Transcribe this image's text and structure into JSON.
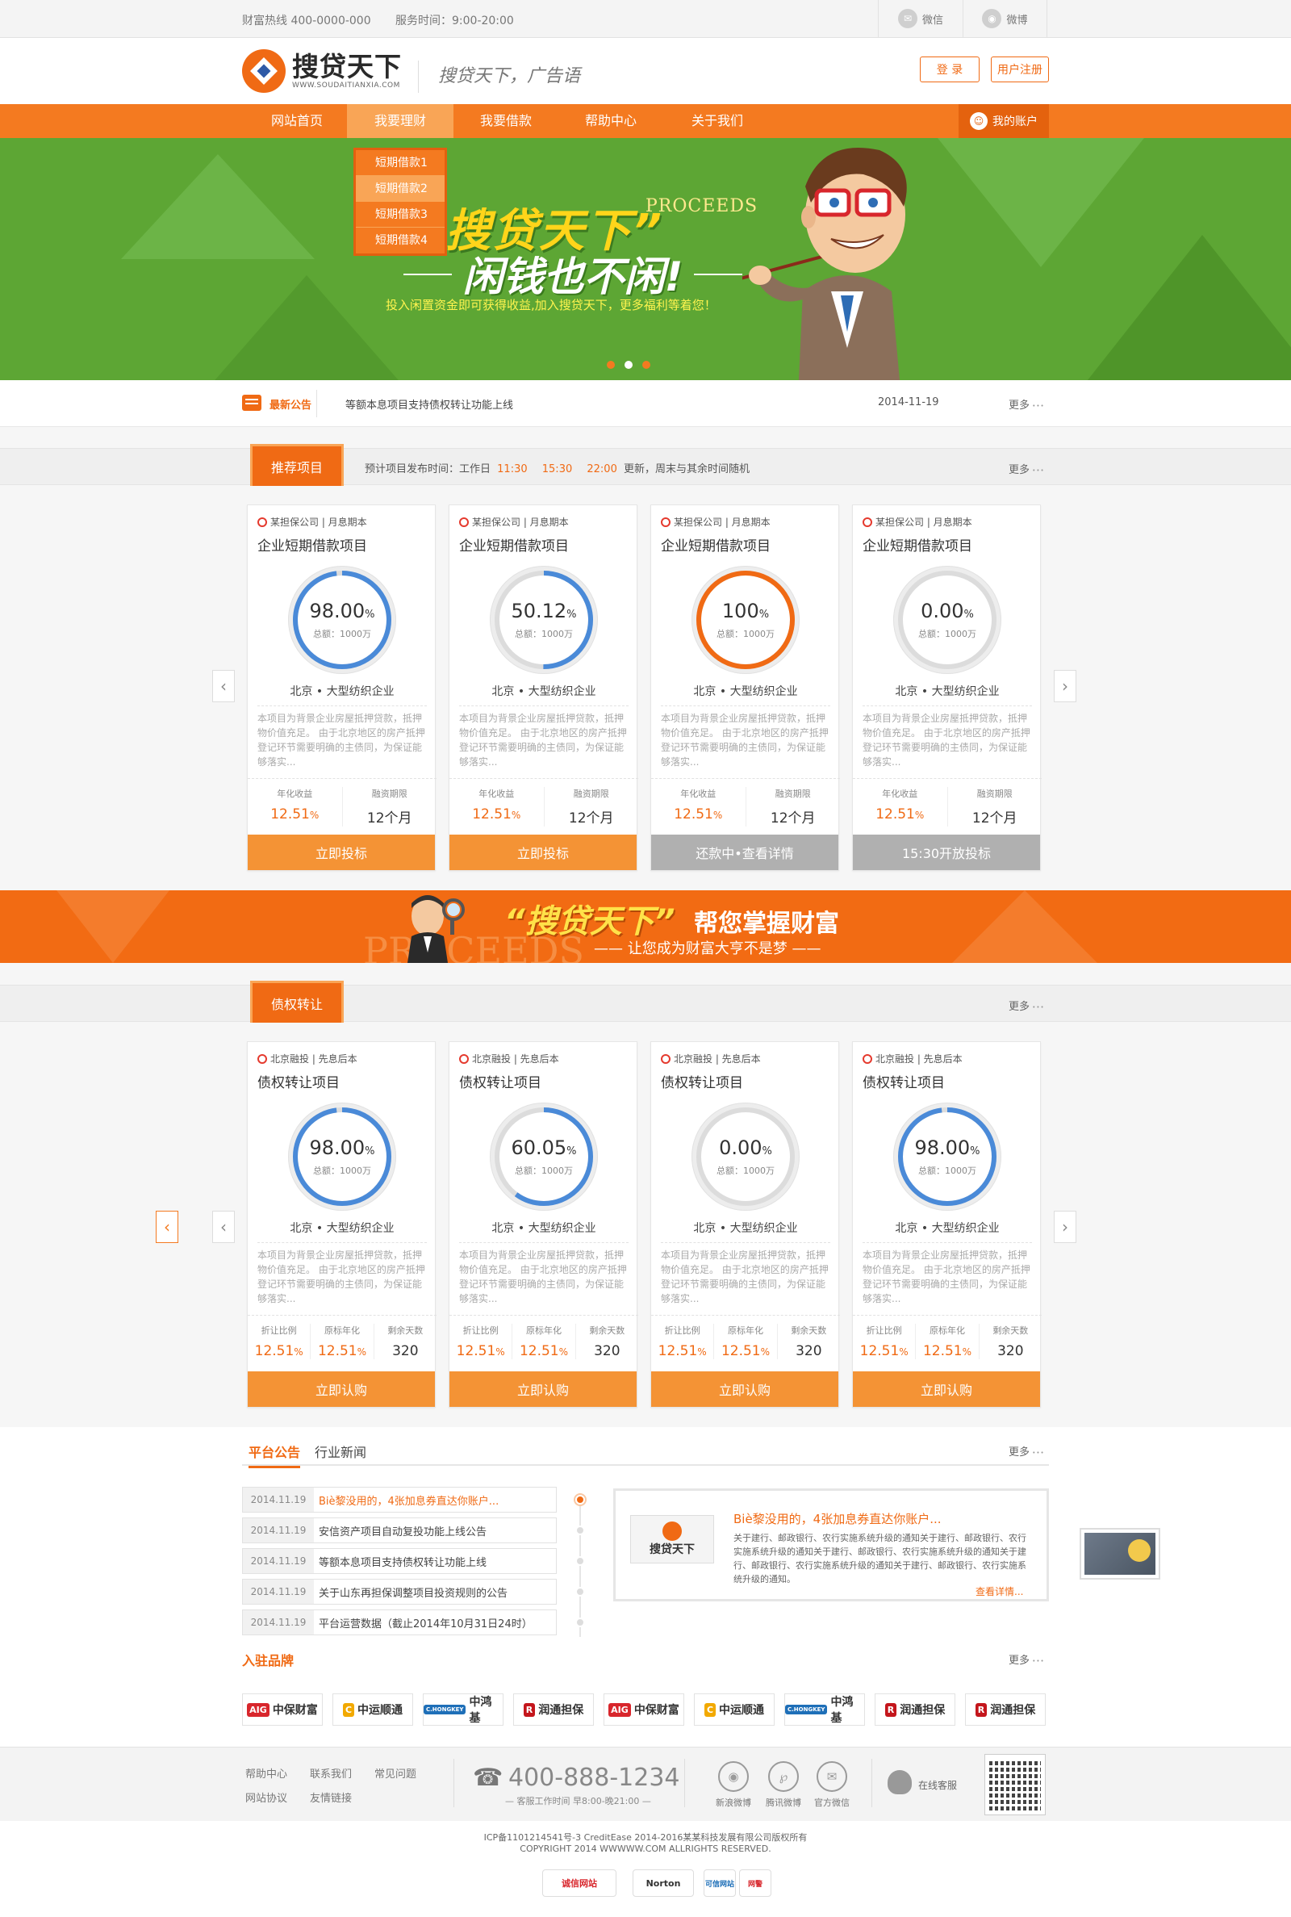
{
  "topbar": {
    "hotline": "财富热线  400-0000-000",
    "hours": "服务时间：9:00-20:00",
    "wechat": "微信",
    "weibo": "微博",
    "wechat_icon": "wechat-icon",
    "weibo_icon": "weibo-icon"
  },
  "header": {
    "logo_cn": "搜贷天下",
    "logo_en": "WWW.SOUDAITIANXIA.COM",
    "slogan": "搜贷天下，广告语",
    "login": "登 录",
    "register": "用户注册"
  },
  "nav": {
    "items": [
      "网站首页",
      "我要理财",
      "我要借款",
      "帮助中心",
      "关于我们"
    ],
    "active": "我要理财",
    "account": "我的账户"
  },
  "dropdown": {
    "items": [
      "短期借款1",
      "短期借款2",
      "短期借款3",
      "短期借款4"
    ],
    "highlighted": "短期借款2"
  },
  "banner": {
    "title": "搜贷天下”",
    "proceeds": "PROCEEDS",
    "subtitle": "闲钱也不闲!",
    "desc": "投入闲置资金即可获得收益,加入搜贷天下，更多福利等着您！",
    "slides": 3,
    "active_slide": 2
  },
  "notice": {
    "label": "最新公告",
    "text": "等额本息项目支持债权转让功能上线",
    "date": "2014-11-19",
    "more": "更多"
  },
  "recommend": {
    "tab": "推荐项目",
    "schedule_prefix": "预计项目发布时间：工作日",
    "times": [
      "11:30",
      "15:30",
      "22:00"
    ],
    "schedule_suffix": "更新，周末与其余时间随机",
    "more": "更多",
    "cards": [
      {
        "source": "某担保公司 | 月息期本",
        "title": "企业短期借款项目",
        "percent": "98.00",
        "pct_value": 98,
        "ring_color": "#4a8ad8",
        "total": "总额：1000万",
        "location": "北京 • 大型纺织企业",
        "desc": "本项目为背景企业房屋抵押贷款，抵押物价值充足。 由于北京地区的房产抵押登记环节需要明确的主债同，为保证能够落实...",
        "s1_label": "年化收益",
        "s1_value": "12.51",
        "s1_unit": "%",
        "s2_label": "融资期限",
        "s2_value": "12个月",
        "button": "立即投标",
        "button_gray": false
      },
      {
        "source": "某担保公司 | 月息期本",
        "title": "企业短期借款项目",
        "percent": "50.12",
        "pct_value": 50.12,
        "ring_color": "#4a8ad8",
        "total": "总额：1000万",
        "location": "北京 • 大型纺织企业",
        "desc": "本项目为背景企业房屋抵押贷款，抵押物价值充足。 由于北京地区的房产抵押登记环节需要明确的主债同，为保证能够落实...",
        "s1_label": "年化收益",
        "s1_value": "12.51",
        "s1_unit": "%",
        "s2_label": "融资期限",
        "s2_value": "12个月",
        "button": "立即投标",
        "button_gray": false
      },
      {
        "source": "某担保公司 | 月息期本",
        "title": "企业短期借款项目",
        "percent": "100",
        "pct_value": 100,
        "ring_color": "#f06a14",
        "total": "总额：1000万",
        "location": "北京 • 大型纺织企业",
        "desc": "本项目为背景企业房屋抵押贷款，抵押物价值充足。 由于北京地区的房产抵押登记环节需要明确的主债同，为保证能够落实...",
        "s1_label": "年化收益",
        "s1_value": "12.51",
        "s1_unit": "%",
        "s2_label": "融资期限",
        "s2_value": "12个月",
        "button": "还款中•查看详情",
        "button_gray": true
      },
      {
        "source": "某担保公司 | 月息期本",
        "title": "企业短期借款项目",
        "percent": "0.00",
        "pct_value": 0,
        "ring_color": "#aaaaaa",
        "total": "总额：1000万",
        "location": "北京 • 大型纺织企业",
        "desc": "本项目为背景企业房屋抵押贷款，抵押物价值充足。 由于北京地区的房产抵押登记环节需要明确的主债同，为保证能够落实...",
        "s1_label": "年化收益",
        "s1_value": "12.51",
        "s1_unit": "%",
        "s2_label": "融资期限",
        "s2_value": "12个月",
        "button": "15:30开放投标",
        "button_gray": true
      }
    ]
  },
  "promo": {
    "title": "“搜贷天下”",
    "title2": "帮您掌握财富",
    "sub": "—— 让您成为财富大亨不是梦 ——",
    "proceeds": "PROCEEDS"
  },
  "transfer": {
    "tab": "债权转让",
    "more": "更多",
    "cards": [
      {
        "source": "北京融投 | 先息后本",
        "title": "债权转让项目",
        "percent": "98.00",
        "pct_value": 98,
        "ring_color": "#4a8ad8",
        "total": "总额：1000万",
        "location": "北京 • 大型纺织企业",
        "desc": "本项目为背景企业房屋抵押贷款，抵押物价值充足。 由于北京地区的房产抵押登记环节需要明确的主债同，为保证能够落实...",
        "l1": "折让比例",
        "v1": "12.51",
        "l2": "原标年化",
        "v2": "12.51",
        "l3": "剩余天数",
        "v3": "320",
        "button": "立即认购"
      },
      {
        "source": "北京融投 | 先息后本",
        "title": "债权转让项目",
        "percent": "60.05",
        "pct_value": 60.05,
        "ring_color": "#4a8ad8",
        "total": "总额：1000万",
        "location": "北京 • 大型纺织企业",
        "desc": "本项目为背景企业房屋抵押贷款，抵押物价值充足。 由于北京地区的房产抵押登记环节需要明确的主债同，为保证能够落实...",
        "l1": "折让比例",
        "v1": "12.51",
        "l2": "原标年化",
        "v2": "12.51",
        "l3": "剩余天数",
        "v3": "320",
        "button": "立即认购"
      },
      {
        "source": "北京融投 | 先息后本",
        "title": "债权转让项目",
        "percent": "0.00",
        "pct_value": 0,
        "ring_color": "#aaaaaa",
        "total": "总额：1000万",
        "location": "北京 • 大型纺织企业",
        "desc": "本项目为背景企业房屋抵押贷款，抵押物价值充足。 由于北京地区的房产抵押登记环节需要明确的主债同，为保证能够落实...",
        "l1": "折让比例",
        "v1": "12.51",
        "l2": "原标年化",
        "v2": "12.51",
        "l3": "剩余天数",
        "v3": "320",
        "button": "立即认购"
      },
      {
        "source": "北京融投 | 先息后本",
        "title": "债权转让项目",
        "percent": "98.00",
        "pct_value": 98,
        "ring_color": "#4a8ad8",
        "total": "总额：1000万",
        "location": "北京 • 大型纺织企业",
        "desc": "本项目为背景企业房屋抵押贷款，抵押物价值充足。 由于北京地区的房产抵押登记环节需要明确的主债同，为保证能够落实...",
        "l1": "折让比例",
        "v1": "12.51",
        "l2": "原标年化",
        "v2": "12.51",
        "l3": "剩余天数",
        "v3": "320",
        "button": "立即认购"
      }
    ]
  },
  "news": {
    "tabs": [
      "平台公告",
      "行业新闻"
    ],
    "active_tab": "平台公告",
    "more": "更多",
    "rows": [
      {
        "date": "2014.11.19",
        "text": "Biè黎没用的，4张加息券直达你账户..."
      },
      {
        "date": "2014.11.19",
        "text": "安信资产项目自动复投功能上线公告"
      },
      {
        "date": "2014.11.19",
        "text": "等额本息项目支持债权转让功能上线"
      },
      {
        "date": "2014.11.19",
        "text": "关于山东再担保调整项目投资规则的公告"
      },
      {
        "date": "2014.11.19",
        "text": "平台运营数据（截止2014年10月31日24时）"
      }
    ],
    "detail_title": "Biè黎没用的，4张加息券直达你账户...",
    "detail_text": "关于建行、邮政银行、农行实施系统升级的通知关于建行、邮政银行、农行实施系统升级的通知关于建行、邮政银行、农行实施系统升级的通知关于建行、邮政银行、农行实施系统升级的通知关于建行、邮政银行、农行实施系统升级的通知。",
    "detail_more": "查看详情...",
    "detail_logo": "搜贷天下"
  },
  "brands": {
    "title": "入驻品牌",
    "more": "更多",
    "items": [
      {
        "mark": "AIG",
        "name": "中保财富",
        "color": "#d8262c"
      },
      {
        "mark": "C",
        "name": "中运顺通",
        "color": "#f2a900"
      },
      {
        "mark": "C.HONGKEY",
        "name": "中鸿基",
        "color": "#1e6fb8"
      },
      {
        "mark": "R",
        "name": "润通担保",
        "color": "#c4161c"
      },
      {
        "mark": "AIG",
        "name": "中保财富",
        "color": "#d8262c"
      },
      {
        "mark": "C",
        "name": "中运顺通",
        "color": "#f2a900"
      },
      {
        "mark": "C.HONGKEY",
        "name": "中鸿基",
        "color": "#1e6fb8"
      },
      {
        "mark": "R",
        "name": "润通担保",
        "color": "#c4161c"
      },
      {
        "mark": "R",
        "name": "润通担保",
        "color": "#c4161c"
      }
    ]
  },
  "footer": {
    "links": [
      "帮助中心",
      "联系我们",
      "常见问题",
      "网站协议",
      "友情链接"
    ],
    "phone": "400-888-1234",
    "hours": "— 客服工作时间 早8:00-晚21:00 —",
    "socials": [
      "新浪微博",
      "腾讯微博",
      "官方微信"
    ],
    "online": "在线客服",
    "icp": "ICP备1101214541号-3 CreditEase 2014-2016某某科技发展有限公司版权所有",
    "copyright": "COPYRIGHT 2014 WWWWW.COM ALLRIGHTS RESERVED.",
    "seals": [
      "诚信网站",
      "Norton",
      "可信网站",
      "网警"
    ]
  }
}
